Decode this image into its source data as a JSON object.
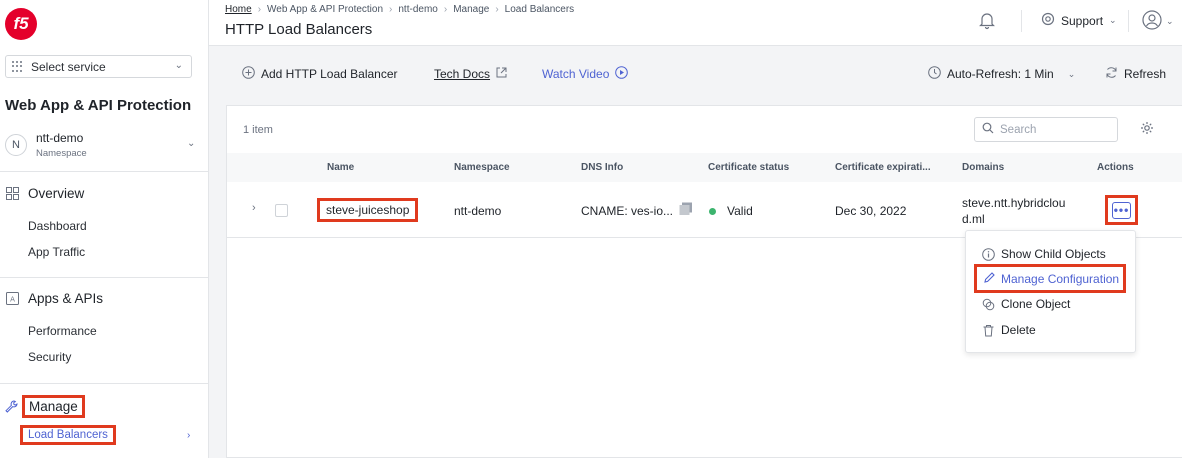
{
  "sidebar": {
    "logo": "f5",
    "service_select": "Select service",
    "app_title": "Web App & API Protection",
    "namespace": {
      "avatar": "N",
      "name": "ntt-demo",
      "label": "Namespace"
    },
    "overview": {
      "title": "Overview",
      "items": [
        "Dashboard",
        "App Traffic"
      ]
    },
    "apps": {
      "title": "Apps & APIs",
      "items": [
        "Performance",
        "Security"
      ]
    },
    "manage": {
      "title": "Manage",
      "items": [
        "Load Balancers"
      ]
    }
  },
  "header": {
    "breadcrumbs": [
      "Home",
      "Web App & API Protection",
      "ntt-demo",
      "Manage",
      "Load Balancers"
    ],
    "title": "HTTP Load Balancers",
    "support": "Support"
  },
  "toolbar": {
    "add": "Add HTTP Load Balancer",
    "tech_docs": "Tech Docs",
    "watch_video": "Watch Video",
    "auto_refresh": "Auto-Refresh: 1 Min",
    "refresh": "Refresh"
  },
  "table": {
    "count": "1 item",
    "search_placeholder": "Search",
    "columns": [
      "Name",
      "Namespace",
      "DNS Info",
      "Certificate status",
      "Certificate expirati...",
      "Domains",
      "Actions"
    ],
    "rows": [
      {
        "name": "steve-juiceshop",
        "namespace": "ntt-demo",
        "dns": "CNAME: ves-io...",
        "cert_status": "Valid",
        "cert_expiration": "Dec 30, 2022",
        "domains_line1": "steve.ntt.hybridclou",
        "domains_line2": "d.ml"
      }
    ]
  },
  "menu": {
    "items": [
      "Show Child Objects",
      "Manage Configuration",
      "Clone Object",
      "Delete"
    ]
  },
  "colors": {
    "accent": "#4f63d2",
    "highlight": "#e03a1e",
    "status_valid": "#3cb46e",
    "brand": "#e4002b"
  }
}
